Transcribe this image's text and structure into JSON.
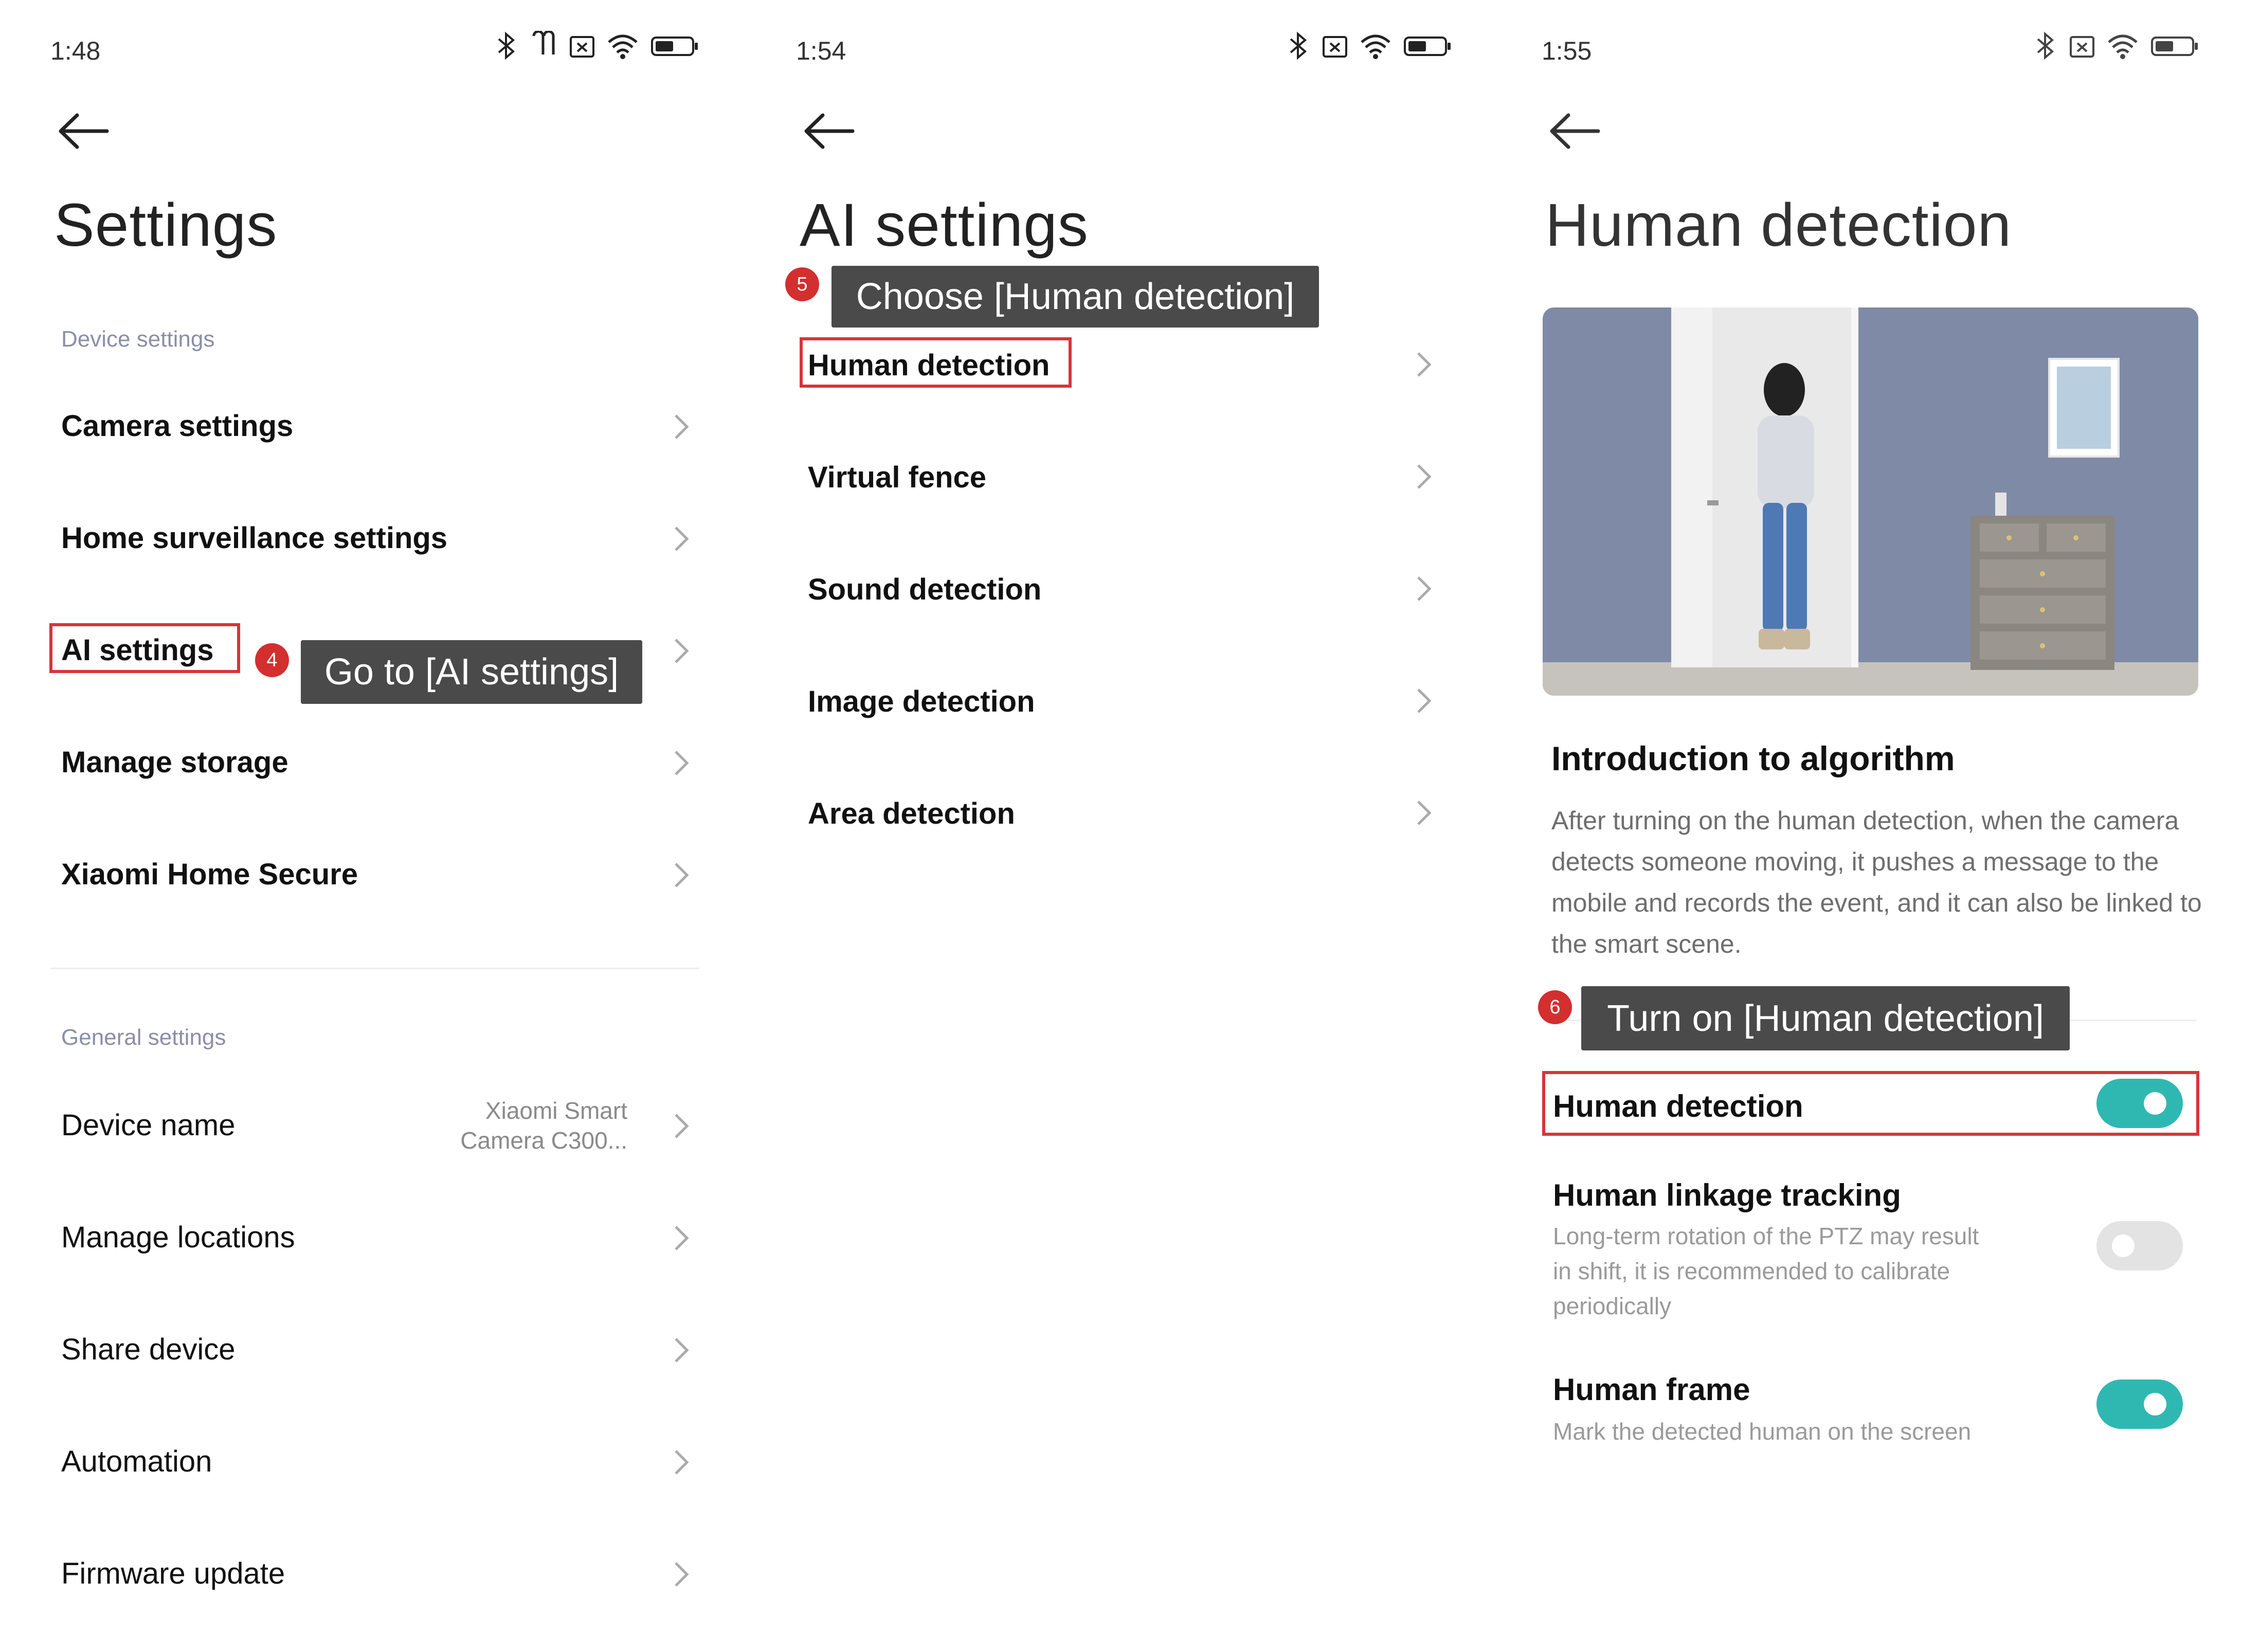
{
  "colors": {
    "accent_red": "#d32f2f",
    "toggle_on": "#2fb8b2",
    "callout_bg": "#4a4a4a"
  },
  "screen1": {
    "time": "1:48",
    "title": "Settings",
    "device_section": "Device settings",
    "device_items": [
      "Camera settings",
      "Home surveillance settings",
      "AI settings",
      "Manage storage",
      "Xiaomi Home Secure"
    ],
    "general_section": "General settings",
    "device_name": {
      "label": "Device name",
      "value_line1": "Xiaomi Smart",
      "value_line2": "Camera C300..."
    },
    "general_items": [
      "Manage locations",
      "Share device",
      "Automation",
      "Firmware update"
    ],
    "step": {
      "number": "4",
      "text": "Go to [AI settings]"
    }
  },
  "screen2": {
    "time": "1:54",
    "title": "AI settings",
    "items": [
      "Human detection",
      "Virtual fence",
      "Sound detection",
      "Image detection",
      "Area detection"
    ],
    "step": {
      "number": "5",
      "text": "Choose [Human detection]"
    }
  },
  "screen3": {
    "time": "1:55",
    "title": "Human detection",
    "intro_title": "Introduction to algorithm",
    "intro_text": "After turning on the human detection, when the camera detects someone moving, it pushes a message to the mobile and records the event, and it can also be linked to the smart scene.",
    "step": {
      "number": "6",
      "text": "Turn on [Human detection]"
    },
    "human_detection": {
      "label": "Human detection",
      "on": true
    },
    "linkage": {
      "label": "Human linkage tracking",
      "desc_line1": "Long-term rotation of the PTZ may result",
      "desc_line2": "in shift, it is recommended to calibrate",
      "desc_line3": "periodically",
      "on": false
    },
    "frame": {
      "label": "Human frame",
      "desc": "Mark the detected human on the screen",
      "on": true
    }
  }
}
